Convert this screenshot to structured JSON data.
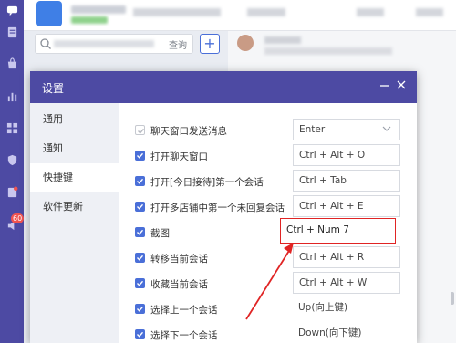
{
  "rail": {
    "icons": [
      "chat-icon",
      "document-icon",
      "bag-icon",
      "chart-icon",
      "apps-icon",
      "shield-icon",
      "task-icon",
      "speaker-icon"
    ],
    "badge": "60",
    "color": "#4d4aa3"
  },
  "search": {
    "label": "查询"
  },
  "modal": {
    "title": "设置",
    "nav": [
      "通用",
      "通知",
      "快捷键",
      "软件更新"
    ],
    "active_nav": "快捷键",
    "rows": [
      {
        "label": "聊天窗口发送消息",
        "key": "Enter",
        "checked": true,
        "disabled": true,
        "type": "select"
      },
      {
        "label": "打开聊天窗口",
        "key": "Ctrl + Alt + O",
        "checked": true,
        "type": "input"
      },
      {
        "label": "打开[今日接待]第一个会话",
        "key": "Ctrl + Tab",
        "checked": true,
        "type": "input"
      },
      {
        "label": "打开多店铺中第一个未回复会话",
        "key": "Ctrl + Alt + E",
        "checked": true,
        "type": "input"
      },
      {
        "label": "截图",
        "key": "Ctrl + Num 7",
        "checked": true,
        "type": "input",
        "highlighted": true
      },
      {
        "label": "转移当前会话",
        "key": "Ctrl + Alt + R",
        "checked": true,
        "type": "input"
      },
      {
        "label": "收藏当前会话",
        "key": "Ctrl + Alt + W",
        "checked": true,
        "type": "input"
      },
      {
        "label": "选择上一个会话",
        "key": "Up(向上键)",
        "checked": true,
        "type": "plain"
      },
      {
        "label": "选择下一个会话",
        "key": "Down(向下键)",
        "checked": true,
        "type": "plain"
      }
    ]
  },
  "colors": {
    "brand": "#4d4aa3",
    "checkbox": "#4a6fd8",
    "annotation": "#e02424"
  }
}
